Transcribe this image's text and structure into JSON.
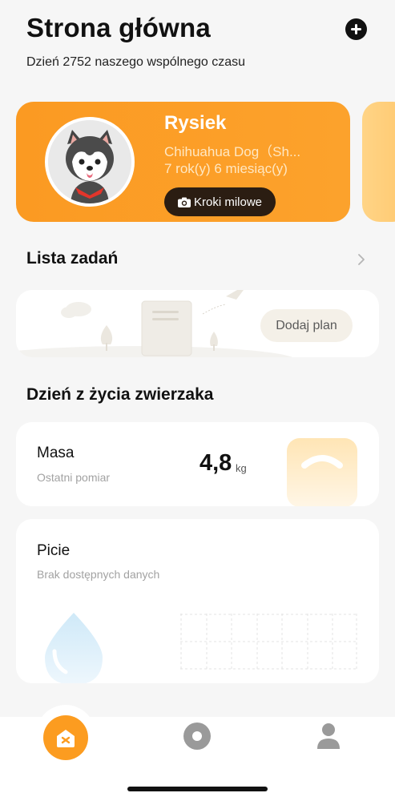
{
  "header": {
    "title": "Strona główna",
    "subtitle": "Dzień 2752 naszego wspólnego czasu",
    "add_icon": "plus-circle-icon"
  },
  "pet": {
    "name": "Rysiek",
    "breed": "Chihuahua Dog（Sh...",
    "age": "7 rok(y) 6 miesiąc(y)",
    "milestones_label": "Kroki milowe",
    "accent": "#fb9a22"
  },
  "todo": {
    "title": "Lista zadań",
    "add_plan_label": "Dodaj plan"
  },
  "day_life": {
    "title": "Dzień z życia zwierzaka",
    "weight": {
      "title": "Masa",
      "subtitle": "Ostatni pomiar",
      "value": "4,8",
      "unit": "kg"
    },
    "drinking": {
      "title": "Picie",
      "subtitle": "Brak dostępnych danych"
    }
  },
  "tabbar": {
    "items": [
      {
        "name": "home",
        "icon": "home-icon",
        "active": true
      },
      {
        "name": "discover",
        "icon": "circle-icon",
        "active": false
      },
      {
        "name": "profile",
        "icon": "person-icon",
        "active": false
      }
    ]
  }
}
